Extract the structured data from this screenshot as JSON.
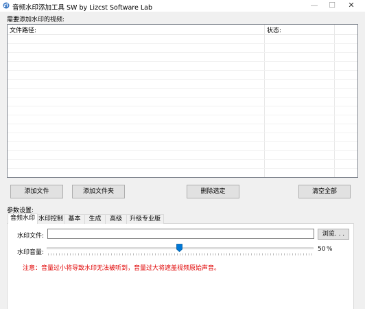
{
  "window": {
    "title": "音频水印添加工具 SW by Lizcst Software Lab",
    "minimize_glyph": "—",
    "maximize_glyph": "☐",
    "close_glyph": "✕",
    "app_icon": "app-icon"
  },
  "video_list": {
    "section_label": "需要添加水印的视频:",
    "columns": [
      "文件路径:",
      "状态:"
    ],
    "rows": []
  },
  "list_buttons": {
    "add_file": "添加文件",
    "add_folder": "添加文件夹",
    "delete_selected": "删除选定",
    "clear_all": "清空全部"
  },
  "params": {
    "section_label": "参数设置:",
    "tabs": [
      "音频水印",
      "水印控制",
      "基本",
      "生成",
      "高级",
      "升级专业版"
    ],
    "active_tab": 0,
    "watermark_file_label": "水印文件:",
    "watermark_file_value": "",
    "browse_label": "浏览. . .",
    "volume_label": "水印音量:",
    "volume_value": 50,
    "volume_unit": "%",
    "note": "注意：音量过小将导致水印无法被听到，音量过大将遮盖视频原始声音。"
  },
  "colors": {
    "accent": "#0078d7",
    "warning": "#e00000"
  }
}
